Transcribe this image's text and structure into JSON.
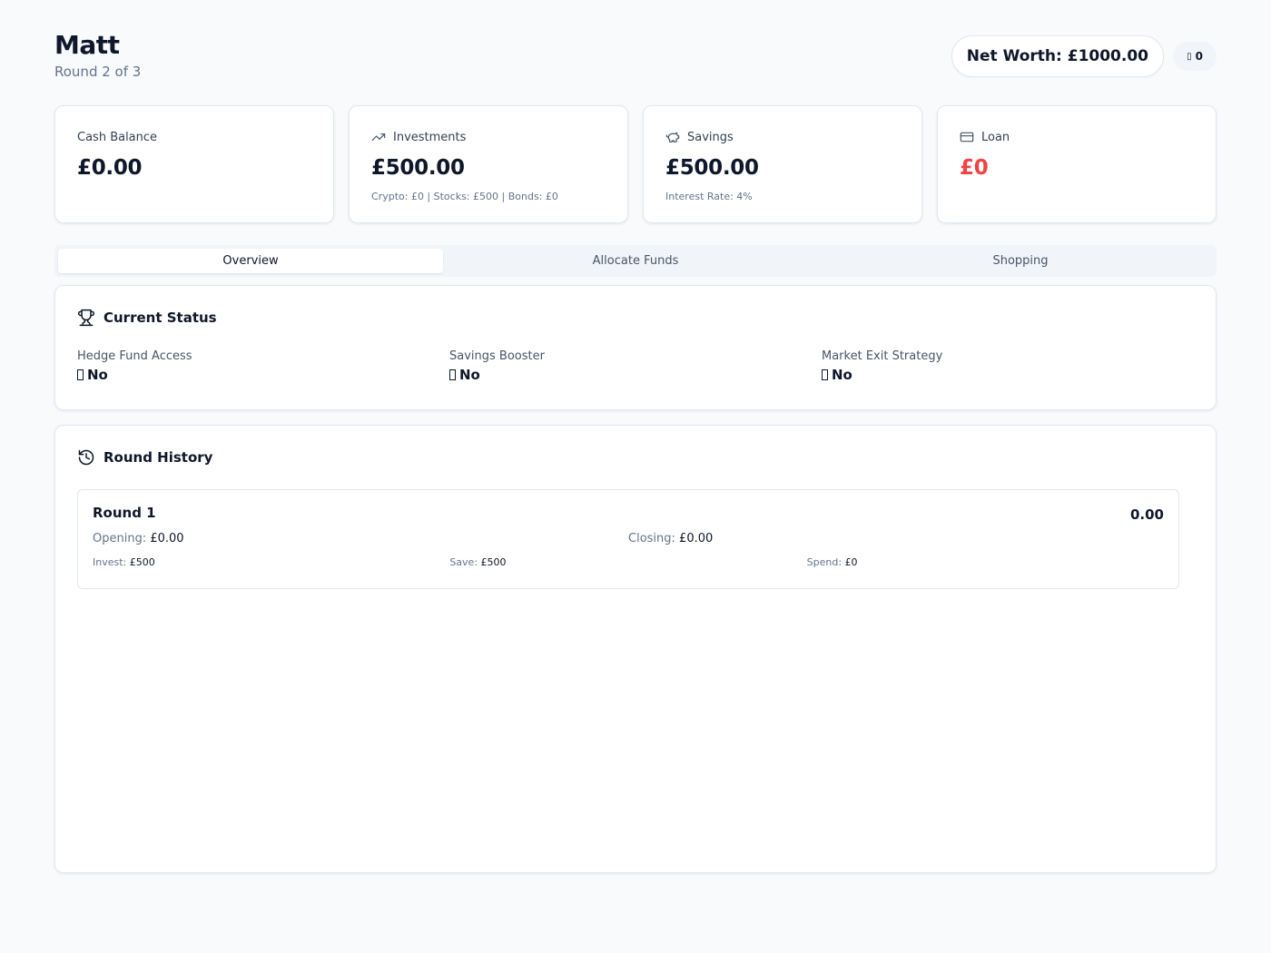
{
  "player": {
    "name": "Matt",
    "round_label": "Round 2 of 3"
  },
  "header": {
    "net_worth": "Net Worth: £1000.00",
    "badge_count": "0",
    "badge_icon": "small-icon"
  },
  "cards": [
    {
      "icon": "none",
      "label": "Cash Balance",
      "value": "£0.00",
      "sub": ""
    },
    {
      "icon": "trending-up-icon",
      "label": "Investments",
      "value": "£500.00",
      "sub": "Crypto: £0 | Stocks: £500 | Bonds: £0"
    },
    {
      "icon": "piggy-bank-icon",
      "label": "Savings",
      "value": "£500.00",
      "sub": "Interest Rate: 4%"
    },
    {
      "icon": "credit-card-icon",
      "label": "Loan",
      "value": "£0",
      "sub": "",
      "value_color": "#ef4444"
    }
  ],
  "tabs": [
    {
      "label": "Overview",
      "active": true
    },
    {
      "label": "Allocate Funds",
      "active": false
    },
    {
      "label": "Shopping",
      "active": false
    }
  ],
  "status": {
    "title": "Current Status",
    "items": [
      {
        "label": "Hedge Fund Access",
        "value": "No"
      },
      {
        "label": "Savings Booster",
        "value": "No"
      },
      {
        "label": "Market Exit Strategy",
        "value": "No"
      }
    ]
  },
  "history": {
    "title": "Round History",
    "rounds": [
      {
        "title": "Round 1",
        "total": "0.00",
        "opening_label": "Opening:",
        "opening": "£0.00",
        "closing_label": "Closing:",
        "closing": "£0.00",
        "invest_label": "Invest:",
        "invest": "£500",
        "save_label": "Save:",
        "save": "£500",
        "spend_label": "Spend:",
        "spend": "£0"
      }
    ]
  }
}
